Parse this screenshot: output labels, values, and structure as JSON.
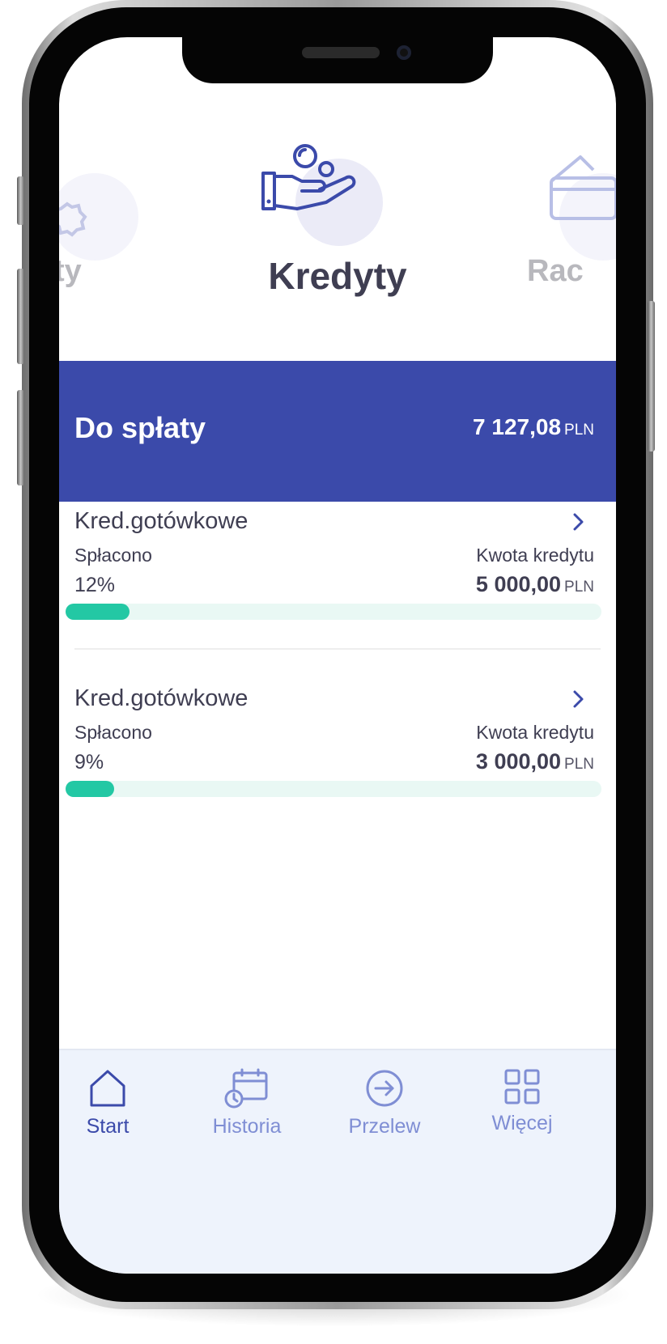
{
  "carousel": {
    "active_title": "Kredyty",
    "left_label": "ty",
    "right_label": "Rac",
    "icons": {
      "active": "hand-coins-icon",
      "left": "gear-icon",
      "right": "wallet-icon"
    }
  },
  "due": {
    "label": "Do spłaty",
    "amount": "7 127,08",
    "currency": "PLN"
  },
  "loans": [
    {
      "name": "Kred.gotówkowe",
      "paid_label": "Spłacono",
      "paid_percent_text": "12%",
      "paid_fraction": 0.12,
      "credit_label": "Kwota kredytu",
      "credit_amount": "5 000,00",
      "currency": "PLN"
    },
    {
      "name": "Kred.gotówkowe",
      "paid_label": "Spłacono",
      "paid_percent_text": "9%",
      "paid_fraction": 0.09,
      "credit_label": "Kwota kredytu",
      "credit_amount": "3 000,00",
      "currency": "PLN"
    }
  ],
  "tabbar": {
    "start": "Start",
    "history": "Historia",
    "transfer": "Przelew",
    "more": "Więcej",
    "active": "start"
  },
  "colors": {
    "brand": "#3b4aaa",
    "progress": "#23c8a4",
    "progress_track": "#e9f8f4",
    "text": "#3f3e52",
    "tab_inactive": "#7f8ed4"
  }
}
